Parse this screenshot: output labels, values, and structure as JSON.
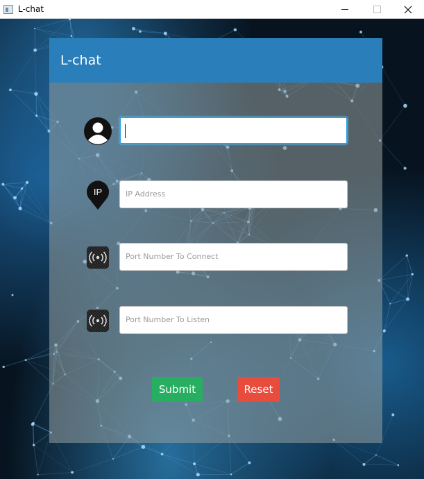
{
  "window": {
    "title": "L-chat",
    "icons": {
      "app": "app-window-icon",
      "minimize": "minimize-icon",
      "maximize": "maximize-icon",
      "close": "close-icon"
    }
  },
  "card": {
    "title": "L-chat",
    "header_color": "#2a7fba"
  },
  "fields": {
    "username": {
      "value": "",
      "placeholder": "",
      "icon": "user-avatar-icon",
      "focused": true
    },
    "ip": {
      "value": "",
      "placeholder": "IP Address",
      "icon": "ip-pin-icon",
      "icon_text": "IP"
    },
    "port_connect": {
      "value": "",
      "placeholder": "Port Number To Connect",
      "icon": "signal-broadcast-icon"
    },
    "port_listen": {
      "value": "",
      "placeholder": "Port Number To Listen",
      "icon": "signal-broadcast-icon"
    }
  },
  "buttons": {
    "submit": {
      "label": "Submit",
      "color": "#27ae60"
    },
    "reset": {
      "label": "Reset",
      "color": "#e74c3c"
    }
  }
}
